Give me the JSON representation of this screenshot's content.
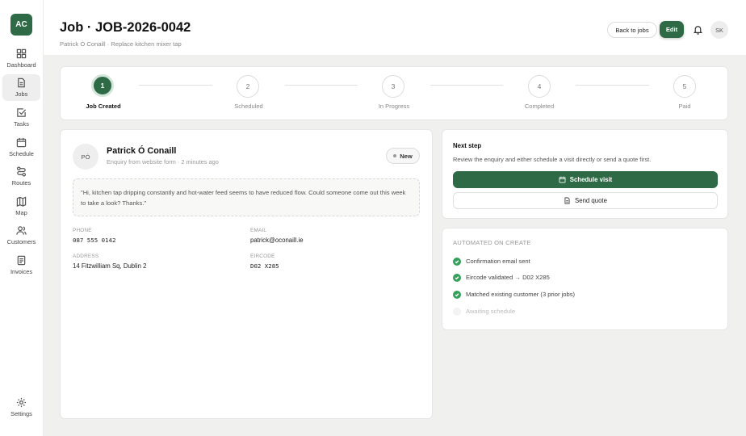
{
  "app": {
    "logo_text": "AC"
  },
  "sidebar": {
    "items": [
      {
        "label": "Dashboard",
        "icon": "dashboard-icon"
      },
      {
        "label": "Jobs",
        "icon": "document-icon",
        "active": true
      },
      {
        "label": "Tasks",
        "icon": "checkbox-icon"
      },
      {
        "label": "Schedule",
        "icon": "calendar-icon"
      },
      {
        "label": "Routes",
        "icon": "route-icon"
      },
      {
        "label": "Map",
        "icon": "map-icon"
      },
      {
        "label": "Customers",
        "icon": "users-icon"
      },
      {
        "label": "Invoices",
        "icon": "invoice-icon"
      }
    ],
    "settings": {
      "label": "Settings",
      "icon": "gear-icon"
    }
  },
  "header": {
    "title": "Job · JOB-2026-0042",
    "subtitle": "Patrick Ó Conaill · Replace kitchen mixer tap",
    "back_label": "Back to jobs",
    "edit_label": "Edit",
    "user_initials": "SK"
  },
  "stepper": {
    "steps": [
      {
        "number": "1",
        "label": "Job Created",
        "active": true
      },
      {
        "number": "2",
        "label": "Scheduled"
      },
      {
        "number": "3",
        "label": "In Progress"
      },
      {
        "number": "4",
        "label": "Completed"
      },
      {
        "number": "5",
        "label": "Paid"
      }
    ]
  },
  "customer": {
    "initials": "PÓ",
    "name": "Patrick Ó Conaill",
    "meta": "Enquiry from website form · 2 minutes ago",
    "status": "New",
    "message": "\"Hi, kitchen tap dripping constantly and hot-water feed seems to have reduced flow. Could someone come out this week to take a look? Thanks.\"",
    "fields": {
      "phone_label": "PHONE",
      "phone": "087 555 0142",
      "email_label": "EMAIL",
      "email": "patrick@oconaill.ie",
      "address_label": "ADDRESS",
      "address": "14 Fitzwilliam Sq, Dublin 2",
      "eircode_label": "EIRCODE",
      "eircode": "D02 X285"
    }
  },
  "next_step": {
    "title": "Next step",
    "description": "Review the enquiry and either schedule a visit directly or send a quote first.",
    "primary_label": "Schedule visit",
    "secondary_label": "Send quote"
  },
  "automated": {
    "title": "AUTOMATED ON CREATE",
    "items": [
      {
        "label": "Confirmation email sent",
        "done": true
      },
      {
        "label": "Eircode validated → D02 X285",
        "done": true
      },
      {
        "label": "Matched existing customer (3 prior jobs)",
        "done": true
      },
      {
        "label": "Awaiting schedule",
        "done": false
      }
    ]
  },
  "colors": {
    "brand": "#2d6a45",
    "success": "#34a05a"
  }
}
